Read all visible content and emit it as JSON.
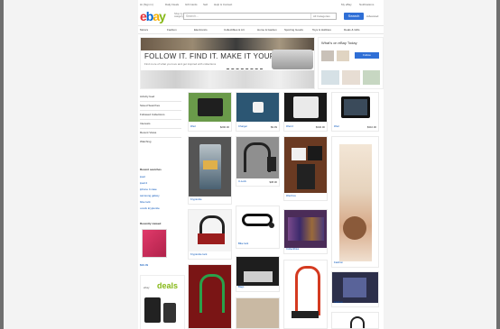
{
  "topbar": {
    "links": [
      "Hi (Sign in)",
      "Daily Deals",
      "Gift Cards",
      "Sell",
      "Help & Contact"
    ],
    "right_links": [
      "My eBay",
      "Notifications"
    ]
  },
  "header": {
    "logo_letters": [
      "e",
      "b",
      "a",
      "y"
    ],
    "tagline": "Shop by category",
    "search_placeholder": "Search...",
    "category_select": "All Categories",
    "search_button": "Search",
    "advanced_link": "Advanced"
  },
  "nav": {
    "items": [
      "Motors",
      "Fashion",
      "Electronics",
      "Collectibles & Art",
      "Home & Garden",
      "Sporting Goods",
      "Toys & Hobbies",
      "Deals & Gifts"
    ]
  },
  "banner": {
    "headline": "FOLLOW IT. FIND IT. MAKE IT YOURS.",
    "subtext": "Find more of what you love and get inspired with collections"
  },
  "feature": {
    "title": "What's on eBay Today",
    "button": "Follow"
  },
  "sidebar": {
    "items": [
      "Activity feed",
      "Saved Searches",
      "Followed Collections",
      "Interests",
      "Recent Views",
      "Watching"
    ],
    "recent_title": "Recent searches",
    "recent_items": [
      "ipad",
      "ipad 2",
      "iphone 4 case",
      "samsung galaxy",
      "bike lock",
      "u-lock kryptonite"
    ],
    "recently_viewed": "Recently viewed",
    "price": "$99.99",
    "deals_prefix": "ebay",
    "deals_word": "deals"
  },
  "tiles": [
    {
      "caption": "iPad",
      "price": "$290.00"
    },
    {
      "caption": "Charger",
      "price": "$9.99"
    },
    {
      "caption": "iPad 2",
      "price": "$340.00"
    },
    {
      "caption": "iPad",
      "price": "$310.00"
    },
    {
      "caption": "Kryptonite",
      "price": "$45.00"
    },
    {
      "caption": "U-Lock",
      "price": "$38.00"
    },
    {
      "caption": "iPad box",
      "price": "$399.00"
    },
    {
      "caption": "Fashion",
      "price": "$24.99"
    },
    {
      "caption": "Kryptonite lock",
      "price": "$52.00"
    },
    {
      "caption": "Bike lock",
      "price": "$29.99"
    },
    {
      "caption": "Collectibles",
      "price": "$15.00"
    },
    {
      "caption": "Fashion",
      "price": "$19.99"
    },
    {
      "caption": "Cable lock",
      "price": "$18.00"
    },
    {
      "caption": "Bags",
      "price": "$34.00"
    },
    {
      "caption": "U-Lock",
      "price": "$49.95"
    },
    {
      "caption": "Mini iPad",
      "price": "$229.00"
    }
  ]
}
